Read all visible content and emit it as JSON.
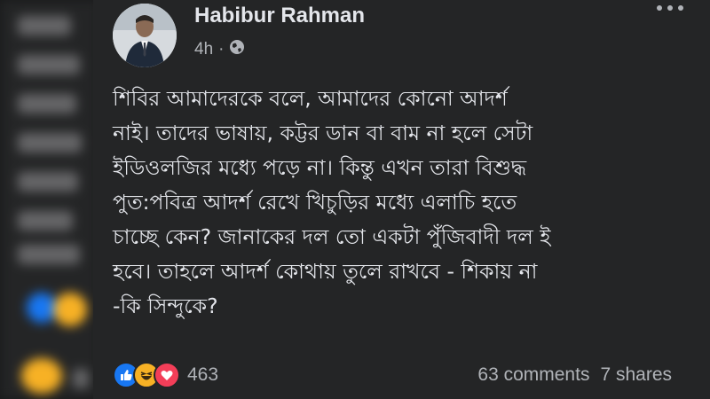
{
  "post": {
    "author": "Habibur Rahman",
    "time": "4h",
    "visibility_icon": "globe-icon",
    "lines": [
      "শিবির আমাদেরকে বলে, আমাদের কোনো আদর্শ",
      "নাই। তাদের ভাষায়,  কট্টর ডান বা বাম না হলে সেটা",
      "ইডিওলজির মধ্যে পড়ে না। কিন্তু এখন তারা বিশুদ্ধ",
      "পুত:পবিত্র  আদর্শ রেখে খিচুড়ির মধ্যে এলাচি হতে",
      "চাচ্ছে কেন? জানাকের দল তো একটা পুঁজিবাদী দল ই",
      "হবে। তাহলে আদর্শ কোথায় তুলে রাখবে - শিকায় না",
      "-কি সিন্দুকে?"
    ]
  },
  "stats": {
    "reaction_icons": [
      "like-icon",
      "haha-icon",
      "love-icon"
    ],
    "reaction_count": "463",
    "comments": "63 comments",
    "shares": "7 shares"
  },
  "colors": {
    "background": "#242526",
    "text": "#e4e6eb",
    "secondary_text": "#b0b3b8",
    "like": "#1877f2",
    "haha": "#f7b125",
    "love": "#f33e58"
  }
}
